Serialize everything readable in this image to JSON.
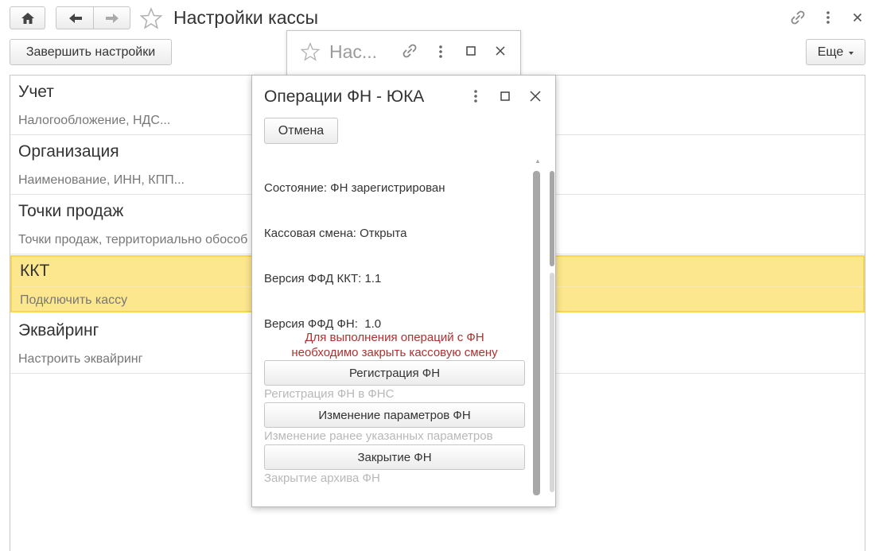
{
  "window": {
    "title": "Настройки кассы"
  },
  "toolbar": {
    "finish_label": "Завершить настройки",
    "more_label": "Еще"
  },
  "sections": [
    {
      "title": "Учет",
      "subtitle": "Налогообложение, НДС..."
    },
    {
      "title": "Организация",
      "subtitle": "Наименование, ИНН, КПП..."
    },
    {
      "title": "Точки продаж",
      "subtitle": "Точки продаж, территориально обособ"
    },
    {
      "title": "ККТ",
      "subtitle": "Подключить кассу"
    },
    {
      "title": "Эквайринг",
      "subtitle": "Настроить эквайринг"
    }
  ],
  "back_window": {
    "title": "Нас..."
  },
  "modal": {
    "title": "Операции ФН - ЮКА",
    "cancel_label": "Отмена",
    "status_lines": [
      "Состояние: ФН зарегистрирован",
      "Кассовая смена: Открыта",
      "Версия ФФД ККТ: 1.1",
      "Версия ФФД ФН:  1.0"
    ],
    "warning_line1": "Для выполнения операций с ФН",
    "warning_line2": "необходимо закрыть кассовую смену",
    "operations": [
      {
        "label": "Регистрация ФН",
        "description": "Регистрация ФН в ФНС"
      },
      {
        "label": "Изменение параметров ФН",
        "description": "Изменение ранее указанных параметров"
      },
      {
        "label": "Закрытие ФН",
        "description": "Закрытие архива ФН"
      }
    ]
  },
  "colors": {
    "selected_row": "#fce68e",
    "selected_border": "#f6d74f",
    "warning_text": "#b03030"
  }
}
